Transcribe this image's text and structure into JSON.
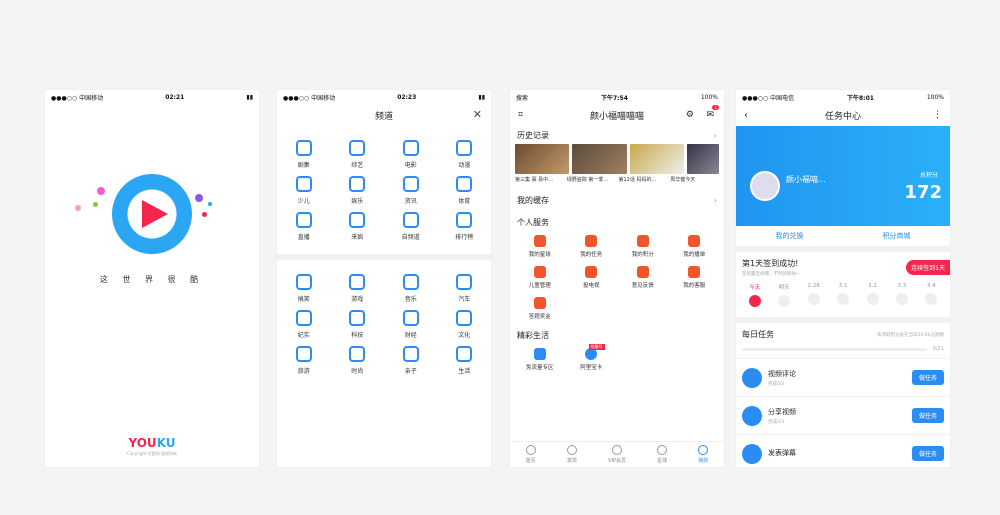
{
  "p1": {
    "status": {
      "carrier": "●●●○○ 中国移动",
      "time": "02:21"
    },
    "slogan": "这 世 界 很 酷",
    "brand_a": "YOU",
    "brand_b": "KU",
    "copy": "Copyright 优酷网 版权所有"
  },
  "p2": {
    "status": {
      "carrier": "●●●○○ 中国移动",
      "time": "02:23"
    },
    "title": "频道",
    "close": "✕",
    "rows1": [
      [
        "剧集",
        "综艺",
        "电影",
        "动漫"
      ],
      [
        "少儿",
        "娱乐",
        "资讯",
        "体育"
      ],
      [
        "直播",
        "来疯",
        "自频道",
        "排行榜"
      ]
    ],
    "rows2": [
      [
        "搞笑",
        "游戏",
        "音乐",
        "汽车"
      ],
      [
        "纪实",
        "科技",
        "财经",
        "文化"
      ],
      [
        "旅游",
        "时尚",
        "亲子",
        "生活"
      ]
    ]
  },
  "p3": {
    "status": {
      "carrier": "搜索",
      "time": "下午7:54",
      "battery": "100%"
    },
    "title": "颜小福喵喵喵",
    "badge": "1",
    "history": "历史记录",
    "hist_caps": [
      "第三集 寡 县中…",
      "绿野盗踪 第一季…",
      "第12话 妈妈的…",
      "周华健今天"
    ],
    "cache": "我的缓存",
    "personal": "个人服务",
    "services": [
      "我的星球",
      "我的任务",
      "我的积分",
      "我的播单",
      "儿童管理",
      "投电视",
      "意见反馈",
      "我的客服",
      "答题奖金"
    ],
    "life": "精彩生活",
    "life_items": [
      "免流量专区",
      "阿里宝卡"
    ],
    "life_tag": "抢靓号",
    "tabs": [
      "首页",
      "发现",
      "VIP会员",
      "星球",
      "我的"
    ]
  },
  "p4": {
    "status": {
      "carrier": "●●●○○ 中国电信",
      "time": "下午8:01",
      "battery": "100%"
    },
    "title": "任务中心",
    "name": "颜小福喵...",
    "points_label": "总积分",
    "points": "172",
    "exchange": "我的兑换",
    "mall": "积分商城",
    "sign_title": "第1天签到成功!",
    "sign_sub": "签到赢连续哦，不然就断啦~",
    "sign_btn": "连续签到1天",
    "days": [
      "今天",
      "明天",
      "2.28",
      "3.1",
      "3.2",
      "3.3",
      "3.4"
    ],
    "daily": "每日任务",
    "daily_note": "未领取积分会在当日24:00过期哦",
    "progress": "0/21",
    "tasks": [
      {
        "name": "视频评论",
        "sub": "完成0/3",
        "btn": "做任务"
      },
      {
        "name": "分享视频",
        "sub": "完成0/3",
        "btn": "做任务"
      },
      {
        "name": "发表弹幕",
        "sub": "",
        "btn": "做任务"
      }
    ]
  }
}
